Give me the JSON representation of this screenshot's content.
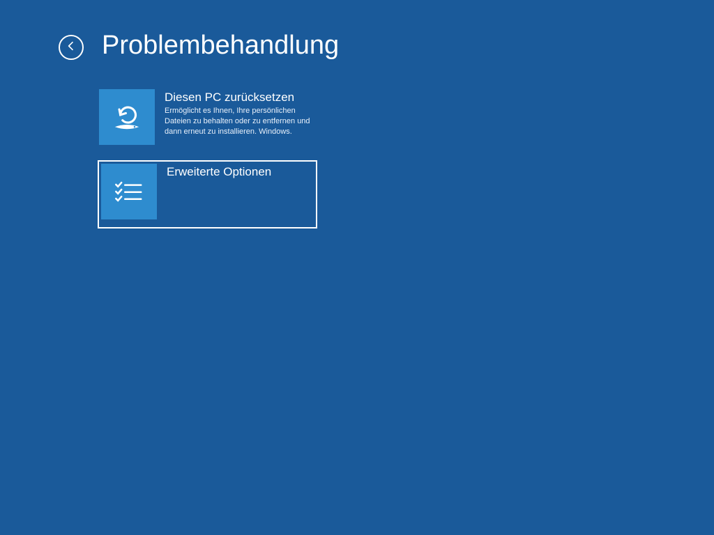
{
  "colors": {
    "background": "#1a5a9a",
    "tile": "#2e8ccf",
    "text": "#ffffff"
  },
  "page": {
    "title": "Problembehandlung"
  },
  "options": [
    {
      "key": "reset-pc",
      "title": "Diesen PC zurücksetzen",
      "description": "Ermöglicht es Ihnen, Ihre persönlichen Dateien zu behalten oder zu entfernen und dann erneut zu installieren. Windows.",
      "icon": "reset-icon",
      "selected": false
    },
    {
      "key": "advanced-options",
      "title": "Erweiterte Optionen",
      "description": "",
      "icon": "checklist-icon",
      "selected": true
    }
  ]
}
